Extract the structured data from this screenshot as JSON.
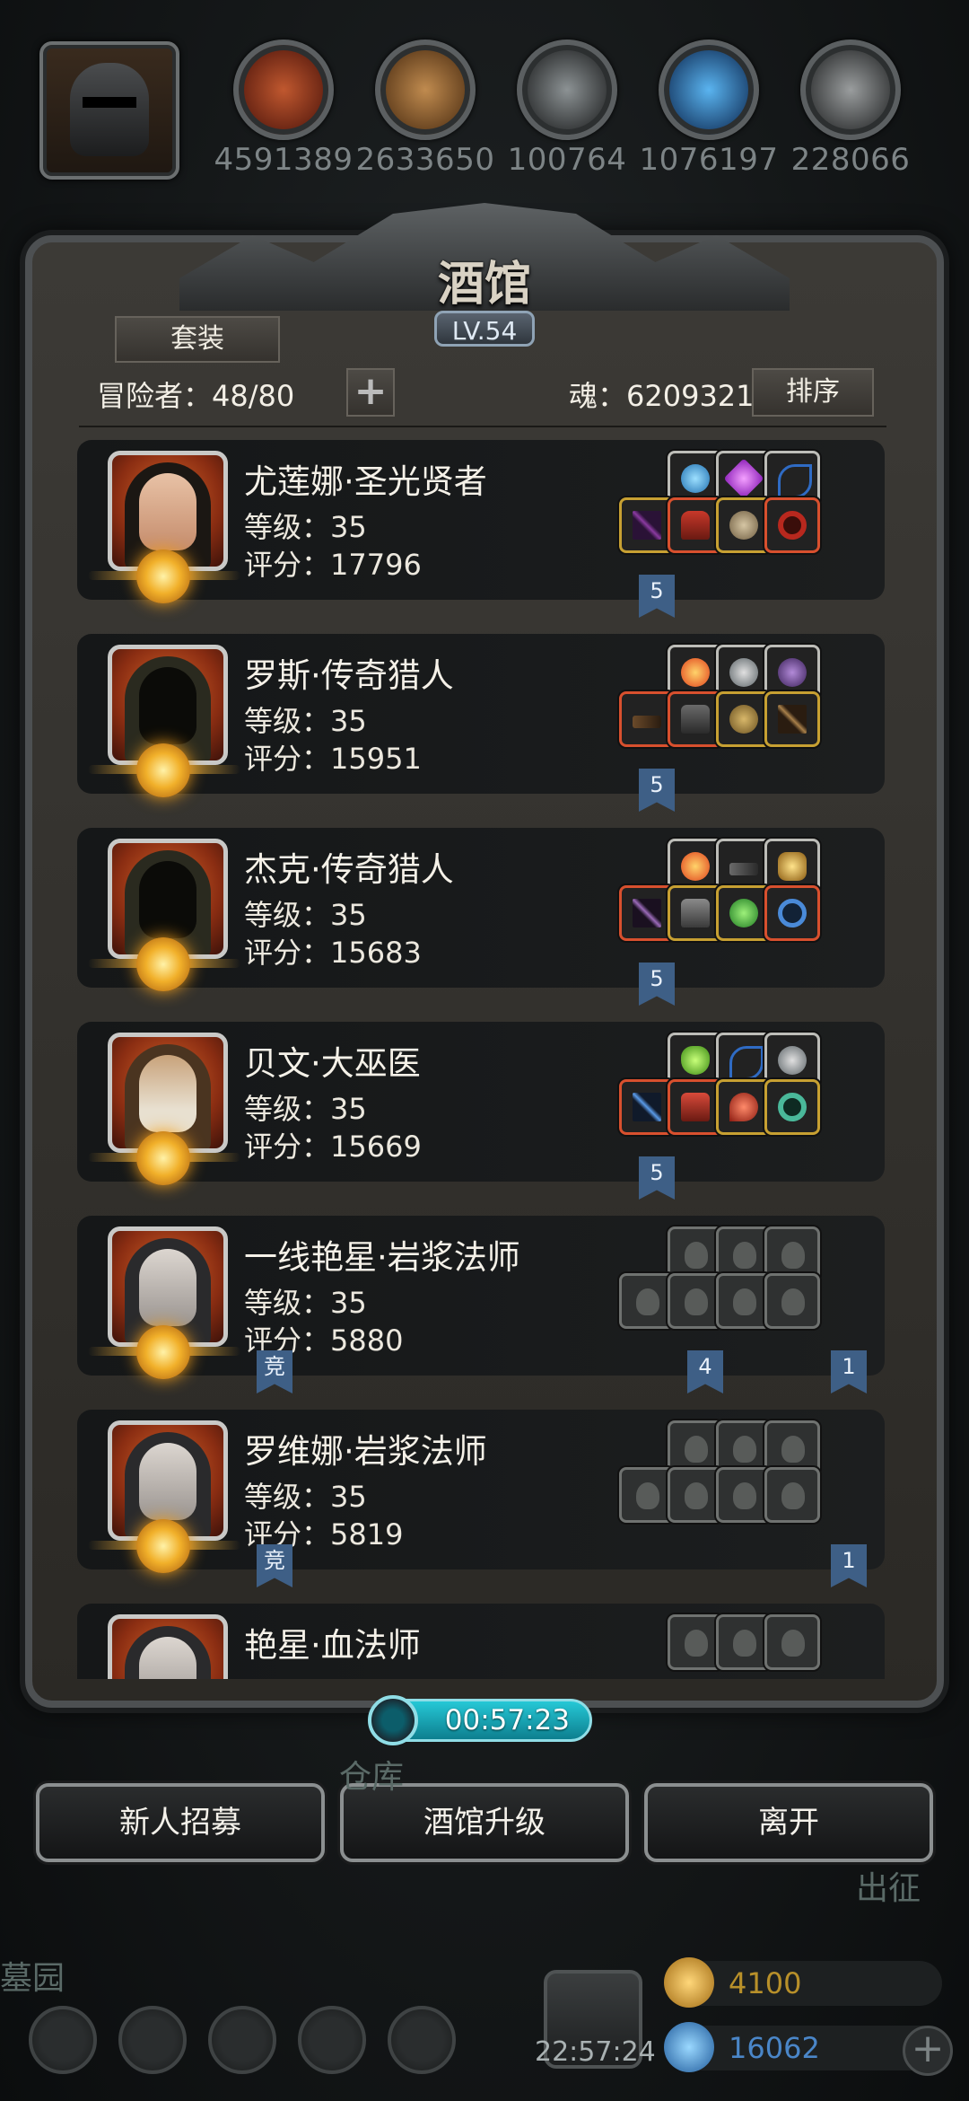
{
  "resources": [
    {
      "icon": "meat-icon",
      "value": "4591389",
      "color": "#8a3c22"
    },
    {
      "icon": "wood-planks-icon",
      "value": "2633650",
      "color": "#8a5a30"
    },
    {
      "icon": "iron-ingot-icon",
      "value": "100764",
      "color": "#55595b"
    },
    {
      "icon": "blue-crystal-icon",
      "value": "1076197",
      "color": "#2d7fbd"
    },
    {
      "icon": "stone-block-icon",
      "value": "228066",
      "color": "#6a6c6d"
    }
  ],
  "panel": {
    "title": "酒馆",
    "level": "LV.54",
    "set_button": "套装",
    "adventurers_label": "冒险者：48/80",
    "plus_label": "+",
    "soul_label": "魂：6209321",
    "sort_button": "排序"
  },
  "heroes": [
    {
      "name": "尤莲娜·圣光贤者",
      "level": "等级：35",
      "score": "评分：17796",
      "tags": [
        {
          "text": "5"
        }
      ]
    },
    {
      "name": "罗斯·传奇猎人",
      "level": "等级：35",
      "score": "评分：15951",
      "tags": [
        {
          "text": "5"
        }
      ]
    },
    {
      "name": "杰克·传奇猎人",
      "level": "等级：35",
      "score": "评分：15683",
      "tags": [
        {
          "text": "5"
        }
      ]
    },
    {
      "name": "贝文·大巫医",
      "level": "等级：35",
      "score": "评分：15669",
      "tags": [
        {
          "text": "5"
        }
      ]
    },
    {
      "name": "一线艳星·岩浆法师",
      "level": "等级：35",
      "score": "评分：5880",
      "tags": [
        {
          "text": "竞"
        },
        {
          "text": "4"
        },
        {
          "text": "1"
        }
      ]
    },
    {
      "name": "罗维娜·岩浆法师",
      "level": "等级：35",
      "score": "评分：5819",
      "tags": [
        {
          "text": "竞"
        },
        {
          "text": "1"
        }
      ]
    },
    {
      "name": "艳星·血法师",
      "level": "",
      "score": "",
      "tags": []
    }
  ],
  "timer": "00:57:23",
  "actions": {
    "recruit": "新人招募",
    "upgrade": "酒馆升级",
    "leave": "离开"
  },
  "hud": {
    "warehouse": "仓库",
    "expedition": "出征",
    "cemetery": "墓园",
    "gold": "4100",
    "gems": "16062",
    "clock": "22:57:24",
    "add": "+"
  }
}
